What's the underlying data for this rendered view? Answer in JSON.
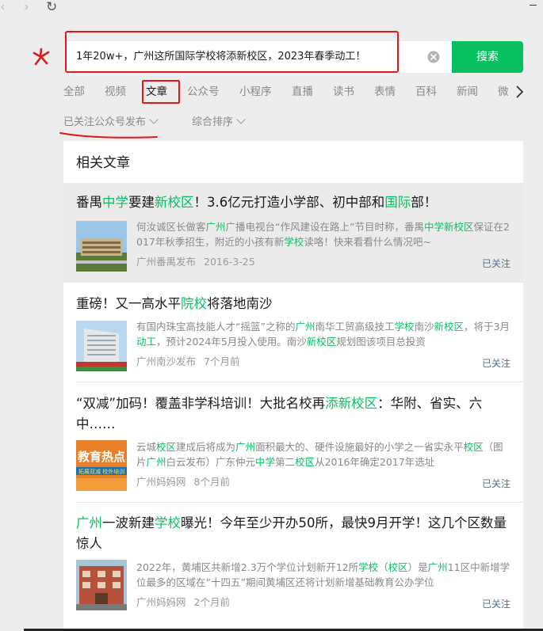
{
  "nav": {
    "back_glyph": "‹",
    "forward_glyph": "›",
    "refresh_glyph": "↻"
  },
  "icons": {
    "back": "back-icon",
    "forward": "forward-icon",
    "refresh": "refresh-icon",
    "logo": "asterisk-logo-icon",
    "clear": "clear-icon",
    "next": "chevron-right-icon"
  },
  "colors": {
    "accent": "#07c160",
    "highlight_red": "#e0191d",
    "follow_link": "#576b95"
  },
  "search": {
    "query": "1年20w+，广州这所国际学校将添新校区，2023年春季动工！",
    "button_label": "搜索"
  },
  "tabs": [
    {
      "label": "全部"
    },
    {
      "label": "视频"
    },
    {
      "label": "文章",
      "active": true
    },
    {
      "label": "公众号"
    },
    {
      "label": "小程序"
    },
    {
      "label": "直播"
    },
    {
      "label": "读书"
    },
    {
      "label": "表情"
    },
    {
      "label": "百科"
    },
    {
      "label": "新闻"
    },
    {
      "label": "微"
    }
  ],
  "filters": {
    "follow_filter": "已关注公众号发布",
    "sort": "综合排序"
  },
  "section_title": "相关文章",
  "articles": [
    {
      "title_parts": [
        [
          "番禺",
          false
        ],
        [
          "中学",
          true
        ],
        [
          "要建",
          false
        ],
        [
          "新校区",
          true
        ],
        [
          "！3.6亿元打造小学部、初中部和",
          false
        ],
        [
          "国际",
          true
        ],
        [
          "部！",
          false
        ]
      ],
      "summary_parts": [
        [
          "何汝诚区长做客",
          false
        ],
        [
          "广州",
          true
        ],
        [
          "广播电视台“作风建设在路上”节目时称，番禺",
          false
        ],
        [
          "中学新校区",
          true
        ],
        [
          "保证在2017年秋季招生，附近的小孩有新",
          false
        ],
        [
          "学校",
          true
        ],
        [
          "读咯！快来看看什么情况吧~",
          false
        ]
      ],
      "source": "广州番禺发布",
      "date": "2016-3-25",
      "follow": "已关注"
    },
    {
      "title_parts": [
        [
          "重磅！又一高水平",
          false
        ],
        [
          "院校",
          true
        ],
        [
          "将",
          false
        ],
        [
          "",
          false
        ],
        [
          "落地南沙",
          false
        ]
      ],
      "summary_parts": [
        [
          "有国内珠宝高技能人才“摇篮”之称的",
          false
        ],
        [
          "广州",
          true
        ],
        [
          "南华工贸高级技工",
          false
        ],
        [
          "学校",
          true
        ],
        [
          "南沙",
          false
        ],
        [
          "新校区",
          true
        ],
        [
          "，将于3月",
          false
        ],
        [
          "动工",
          true
        ],
        [
          "，预计2024年5月投入使用。南沙",
          false
        ],
        [
          "新校区",
          true
        ],
        [
          "规划图该项目总投资",
          false
        ]
      ],
      "source": "广州南沙发布",
      "date": "7个月前",
      "follow": "已关注"
    },
    {
      "title_parts": [
        [
          "“双减”加码！覆盖非学科培训！大批名校再",
          false
        ],
        [
          "添新校区",
          true
        ],
        [
          "：华附、省实、六中……",
          false
        ]
      ],
      "summary_parts": [
        [
          "云城",
          false
        ],
        [
          "校区",
          true
        ],
        [
          "建成后将成为",
          false
        ],
        [
          "广州",
          true
        ],
        [
          "面积最大的、硬件设施最好的小学之一省实永平",
          false
        ],
        [
          "校区",
          true
        ],
        [
          "（图片",
          false
        ],
        [
          "广州",
          true
        ],
        [
          "白云发布）广东仲元",
          false
        ],
        [
          "中学",
          true
        ],
        [
          "第二",
          false
        ],
        [
          "校区",
          true
        ],
        [
          "从2016年确定2017年选址",
          false
        ]
      ],
      "source": "广州妈妈网",
      "date": "8个月前",
      "follow": "已关注"
    },
    {
      "title_parts": [
        [
          "广州",
          true
        ],
        [
          "一波新建",
          false
        ],
        [
          "学校",
          true
        ],
        [
          "曝光！今年至少开办50所，最快9月开学！这几个区数量惊人",
          false
        ]
      ],
      "summary_parts": [
        [
          "2022年，黄埔区共新增2.3万个学位计划新开12所",
          false
        ],
        [
          "学校",
          true
        ],
        [
          "（",
          false
        ],
        [
          "校区",
          true
        ],
        [
          "）是",
          false
        ],
        [
          "广州",
          true
        ],
        [
          "11区中新增学位最多的区域在“十四五”期间黄埔区还将计划新增基础教育公办学位",
          false
        ]
      ],
      "source": "广州妈妈网",
      "date": "2个月前",
      "follow": "已关注"
    }
  ],
  "thumb_texts": {
    "article_3": "教育热点",
    "article_3_sub": "拓展双减 校外培训"
  }
}
